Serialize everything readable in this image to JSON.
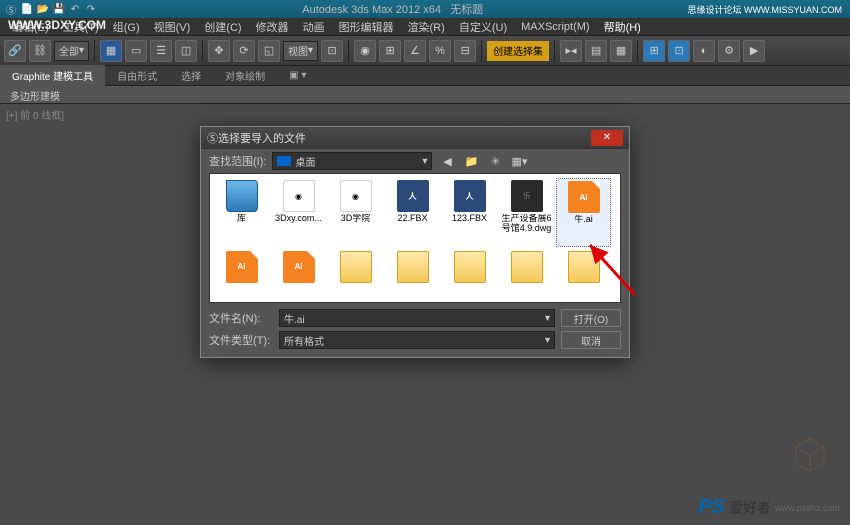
{
  "app_title": "Autodesk 3ds Max 2012 x64",
  "title_suffix": "无标题",
  "watermark_tr_label": "思缘设计论坛",
  "watermark_tr_url": "WWW.MISSYUAN.COM",
  "watermark_tl": "WWW.3DXY.COM",
  "watermark_br": {
    "ps": "PS",
    "txt": "爱好者",
    "url": "www.psahz.com"
  },
  "menu": [
    "编辑(E)",
    "工具(T)",
    "组(G)",
    "视图(V)",
    "创建(C)",
    "修改器",
    "动画",
    "图形编辑器",
    "渲染(R)",
    "自定义(U)",
    "MAXScript(M)",
    "帮助(H)"
  ],
  "toolbar_all": "全部",
  "toolbar_view": "视图",
  "toolbar_create_sel": "创建选择集",
  "ribbon": {
    "tabs": [
      "Graphite 建模工具",
      "自由形式",
      "选择",
      "对象绘制"
    ],
    "sub": "多边形建模"
  },
  "viewport_label": "[+] 前 0 线框]",
  "dialog": {
    "title": "选择要导入的文件",
    "lookin_label": "查找范围(I):",
    "lookin_value": "桌面",
    "files": [
      {
        "icon": "folder-open",
        "label": "库"
      },
      {
        "icon": "app",
        "label": "3Dxy.com..."
      },
      {
        "icon": "app",
        "label": "3D学院"
      },
      {
        "icon": "fbx",
        "label": "22.FBX"
      },
      {
        "icon": "fbx",
        "label": "123.FBX"
      },
      {
        "icon": "dwg",
        "label": "生产设备展6号馆4.9.dwg"
      },
      {
        "icon": "ai",
        "label": "牛.ai",
        "selected": true
      },
      {
        "icon": "ai",
        "label": ""
      },
      {
        "icon": "ai",
        "label": ""
      },
      {
        "icon": "folder",
        "label": ""
      },
      {
        "icon": "folder",
        "label": ""
      },
      {
        "icon": "folder",
        "label": ""
      },
      {
        "icon": "folder",
        "label": ""
      },
      {
        "icon": "folder",
        "label": ""
      }
    ],
    "filename_label": "文件名(N):",
    "filename_value": "牛.ai",
    "filetype_label": "文件类型(T):",
    "filetype_value": "所有格式",
    "open_btn": "打开(O)",
    "cancel_btn": "取消"
  }
}
